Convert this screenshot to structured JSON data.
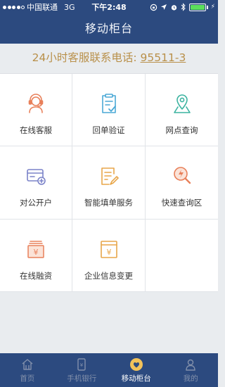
{
  "status_bar": {
    "carrier": "中国联通",
    "network": "3G",
    "time": "下午2:48",
    "signal_bars": 4,
    "battery_level": 1.0
  },
  "header": {
    "title": "移动柜台"
  },
  "hotline": {
    "label": "24小时客服联系电话: ",
    "number": "95511-3"
  },
  "services": [
    {
      "label": "在线客服",
      "icon": "customer-service-icon",
      "color": "#e8805a"
    },
    {
      "label": "回单验证",
      "icon": "receipt-check-icon",
      "color": "#4ba9d6"
    },
    {
      "label": "网点查询",
      "icon": "location-pin-icon",
      "color": "#3bb3a0"
    },
    {
      "label": "对公开户",
      "icon": "account-card-icon",
      "color": "#7b83c9"
    },
    {
      "label": "智能填单服务",
      "icon": "form-edit-icon",
      "color": "#e8a64a"
    },
    {
      "label": "快速查询区",
      "icon": "quick-search-icon",
      "color": "#e8805a"
    },
    {
      "label": "在线融资",
      "icon": "financing-icon",
      "color": "#e8805a"
    },
    {
      "label": "企业信息变更",
      "icon": "enterprise-info-icon",
      "color": "#e8a64a"
    }
  ],
  "tabbar": {
    "items": [
      {
        "label": "首页",
        "icon": "home-icon",
        "active": false
      },
      {
        "label": "手机银行",
        "icon": "mobile-bank-icon",
        "active": false
      },
      {
        "label": "移动柜台",
        "icon": "heart-counter-icon",
        "active": true
      },
      {
        "label": "我的",
        "icon": "user-icon",
        "active": false
      }
    ]
  }
}
